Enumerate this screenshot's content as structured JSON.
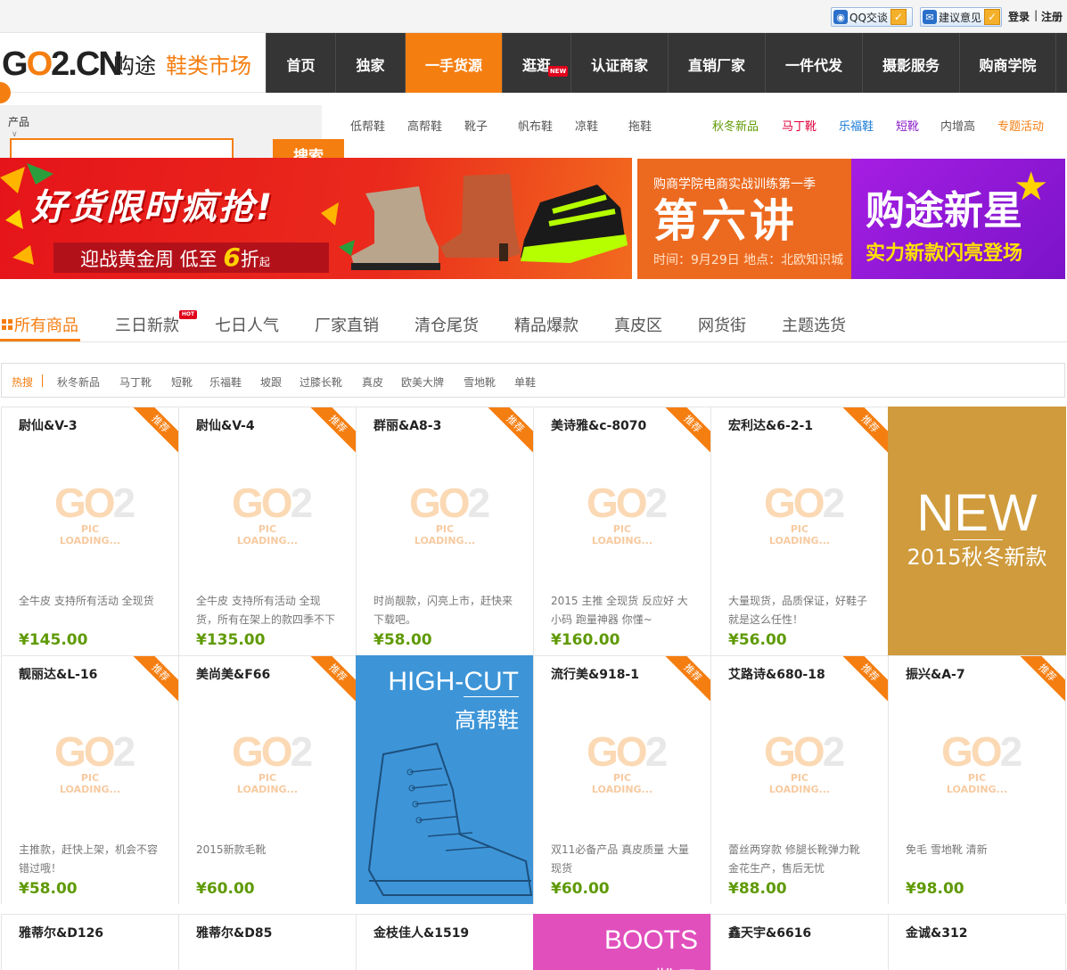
{
  "topbar": {
    "qq_label": "QQ交谈",
    "feedback_label": "建议意见",
    "login": "登录",
    "separator": "|",
    "register": "注册"
  },
  "logo": {
    "go": "G",
    "o": "O",
    "num": "2.CN",
    "cn": "购途",
    "market": "鞋类市场"
  },
  "nav": {
    "items": [
      "首页",
      "独家",
      "一手货源",
      "逛逛",
      "认证商家",
      "直销厂家",
      "一件代发",
      "摄影服务",
      "购商学院"
    ],
    "active_index": 2,
    "new_badge": "NEW"
  },
  "search": {
    "category": "产品",
    "category_arrow": "∨",
    "button": "搜索",
    "value": ""
  },
  "keywords": {
    "left": [
      "低帮鞋",
      "高帮鞋",
      "靴子",
      "帆布鞋",
      "凉鞋",
      "拖鞋"
    ],
    "right": [
      {
        "text": "秋冬新品",
        "color": "#5f9a05"
      },
      {
        "text": "马丁靴",
        "color": "#e0003c"
      },
      {
        "text": "乐福鞋",
        "color": "#1a7bd6"
      },
      {
        "text": "短靴",
        "color": "#8b1ec8"
      },
      {
        "text": "内增高",
        "color": "#555555"
      },
      {
        "text": "专题活动",
        "color": "#f57e11"
      }
    ]
  },
  "banners": {
    "main_title": "好货限时疯抢!",
    "main_sub_a": "迎战黄金周 低至",
    "main_sub_num": "6",
    "main_sub_b": "折",
    "main_sub_c": "起",
    "b2_top": "购商学院电商实战训练第一季",
    "b2_big": "第六讲",
    "b2_bottom": "时间：9月29日 地点：北欧知识城",
    "b3_big": "购途新星",
    "b3_sub": "实力新款闪亮登场"
  },
  "tabs": {
    "items": [
      "所有商品",
      "三日新款",
      "七日人气",
      "厂家直销",
      "清仓尾货",
      "精品爆款",
      "真皮区",
      "网货街",
      "主题选货"
    ],
    "hot_badge": "HOT"
  },
  "hot_search": {
    "label": "热搜",
    "items": [
      "秋冬新品",
      "马丁靴",
      "短靴",
      "乐福鞋",
      "坡跟",
      "过膝长靴",
      "真皮",
      "欧美大牌",
      "雪地靴",
      "单鞋"
    ]
  },
  "placeholder": {
    "go": "GO",
    "two": "2",
    "sub": "PIC LOADING..."
  },
  "ribbon_label": "推荐",
  "products": [
    {
      "title": "尉仙&V-3",
      "desc": "全牛皮 支持所有活动 全现货",
      "price": "¥145.00"
    },
    {
      "title": "尉仙&V-4",
      "desc": "全牛皮 支持所有活动 全现货，所有在架上的款四季不下",
      "price": "¥135.00"
    },
    {
      "title": "群丽&A8-3",
      "desc": "时尚靓款，闪亮上市，赶快来下载吧。",
      "price": "¥58.00"
    },
    {
      "title": "美诗雅&c-8070",
      "desc": "2015 主推 全现货 反应好 大小码 跑量神器 你懂~",
      "price": "¥160.00"
    },
    {
      "title": "宏利达&6-2-1",
      "desc": "大量现货，品质保证，好鞋子就是这么任性！",
      "price": "¥56.00"
    },
    {
      "title": "靓丽达&L-16",
      "desc": "主推款，赶快上架，机会不容错过哦！",
      "price": "¥58.00"
    },
    {
      "title": "美尚美&F66",
      "desc": "2015新款毛靴",
      "price": "¥60.00"
    },
    {
      "title": "流行美&918-1",
      "desc": "双11必备产品 真皮质量 大量现货",
      "price": "¥60.00"
    },
    {
      "title": "艾路诗&680-18",
      "desc": "蕾丝两穿款 修腿长靴弹力靴 金花生产，售后无忧",
      "price": "¥88.00"
    },
    {
      "title": "振兴&A-7",
      "desc": "免毛 雪地靴 清新",
      "price": "¥98.00"
    },
    {
      "title": "雅蒂尔&D126"
    },
    {
      "title": "雅蒂尔&D85"
    },
    {
      "title": "金枝佳人&1519"
    },
    {
      "title": "鑫天宇&6616"
    },
    {
      "title": "金诚&312"
    }
  ],
  "features": {
    "new_big": "NEW",
    "new_sub": "2015秋冬新款",
    "hc_en_a": "HIGH-",
    "hc_en_b": "CUT",
    "hc_cn": "高帮鞋",
    "boots_en": "BOOTS",
    "boots_cn": "靴子"
  },
  "colors": {
    "accent": "#f57e11",
    "nav_bg": "#353535",
    "price": "#5f9a05",
    "new_card": "#cf9b3c",
    "highcut_card": "#3d95d8",
    "boots_card": "#e14fbd"
  }
}
